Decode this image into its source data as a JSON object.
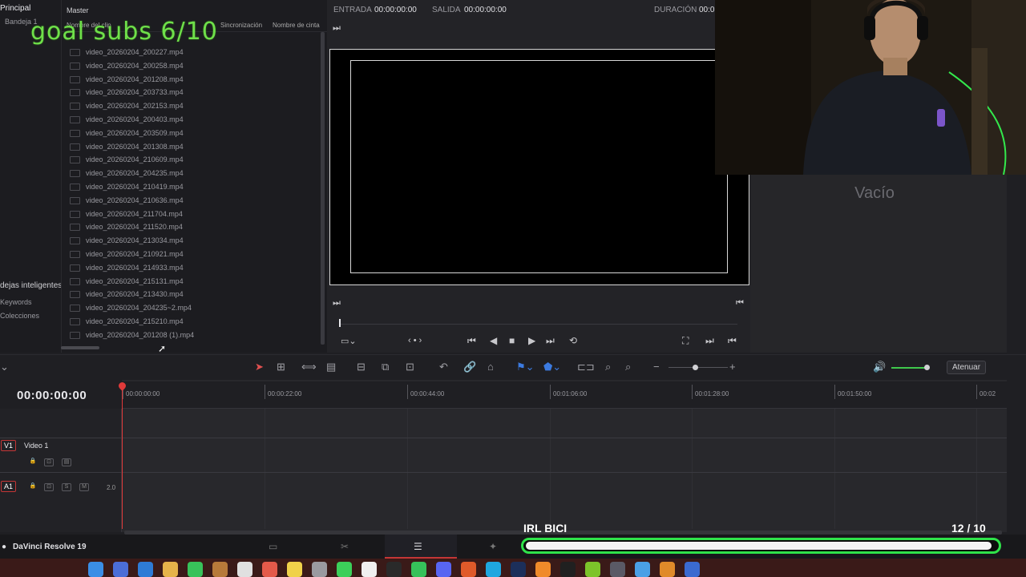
{
  "sidebar": {
    "principal": "Principal",
    "bandeja": "Bandeja 1",
    "smart_bins": "dejas inteligentes",
    "keywords": "Keywords",
    "colecciones": "Colecciones"
  },
  "media": {
    "header": "Master",
    "col_clip_name": "Nombre del clip",
    "col_sync": "Sincronización",
    "col_tape": "Nombre de cinta",
    "files": [
      "video_20260204_200227.mp4",
      "video_20260204_200258.mp4",
      "video_20260204_201208.mp4",
      "video_20260204_203733.mp4",
      "video_20260204_202153.mp4",
      "video_20260204_200403.mp4",
      "video_20260204_203509.mp4",
      "video_20260204_201308.mp4",
      "video_20260204_210609.mp4",
      "video_20260204_204235.mp4",
      "video_20260204_210419.mp4",
      "video_20260204_210636.mp4",
      "video_20260204_211704.mp4",
      "video_20260204_211520.mp4",
      "video_20260204_213034.mp4",
      "video_20260204_210921.mp4",
      "video_20260204_214933.mp4",
      "video_20260204_215131.mp4",
      "video_20260204_213430.mp4",
      "video_20260204_204235~2.mp4",
      "video_20260204_215210.mp4",
      "video_20260204_201208 (1).mp4"
    ]
  },
  "overlay": {
    "goal_text": "goal subs 6/10",
    "irl_label": "IRL BICI",
    "count_text": "12  / 10",
    "progress_fraction": 0.99
  },
  "viewer": {
    "in_label": "ENTRADA",
    "in_value": "00:00:00:00",
    "out_label": "SALIDA",
    "out_value": "00:00:00:00",
    "duration_label": "DURACIÓN",
    "duration_value": "00:0"
  },
  "right_panel": {
    "empty_label": "Vacío"
  },
  "toolbar": {
    "atenuar": "Atenuar"
  },
  "timeline": {
    "timecode": "00:00:00:00",
    "ticks": [
      "00:00:00:00",
      "00:00:22:00",
      "00:00:44:00",
      "00:01:06:00",
      "00:01:28:00",
      "00:01:50:00",
      "00:02"
    ],
    "tracks": {
      "v1_badge": "V1",
      "v1_name": "Video 1",
      "a1_badge": "A1",
      "a1_level": "2.0",
      "a1_solo": "S",
      "a1_mute": "M"
    }
  },
  "app": {
    "name": "DaVinci Resolve 19"
  },
  "colors": {
    "accent_green": "#2fe34a",
    "playhead_red": "#e03a3a",
    "overlay_text_green": "#6fe04a"
  }
}
